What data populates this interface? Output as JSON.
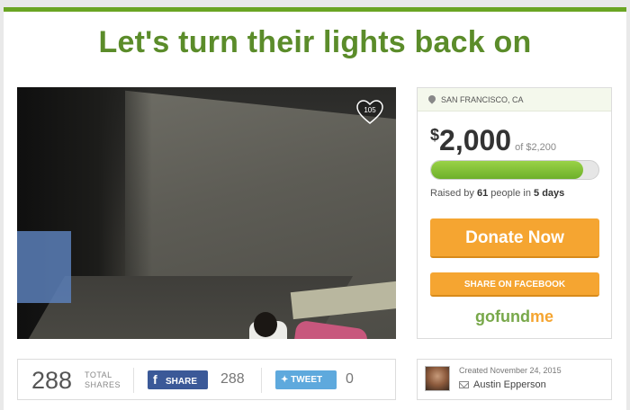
{
  "campaign": {
    "title": "Let's turn their lights back on",
    "hearts": "105"
  },
  "panel": {
    "location": "SAN FRANCISCO, CA",
    "currency_symbol": "$",
    "raised_amount": "2,000",
    "goal_text": "of $2,200",
    "progress_fraction": 0.909,
    "raised_prefix": "Raised by",
    "people_count": "61",
    "people_text": "people in",
    "days": "5 days",
    "donate_label": "Donate Now",
    "facebook_label": "SHARE ON FACEBOOK",
    "logo": {
      "go": "go",
      "fund": "fund",
      "me": "me"
    }
  },
  "shares": {
    "total": "288",
    "total_label_1": "TOTAL",
    "total_label_2": "SHARES",
    "fb_label": "SHARE",
    "fb_count": "288",
    "tweet_label": "TWEET",
    "tweet_count": "0"
  },
  "creator": {
    "created_text": "Created November 24, 2015",
    "name": "Austin Epperson"
  },
  "colors": {
    "brand_green": "#5b8c2a",
    "donate_orange": "#f5a531",
    "facebook_blue": "#3b5998",
    "twitter_blue": "#5ea9dd"
  }
}
